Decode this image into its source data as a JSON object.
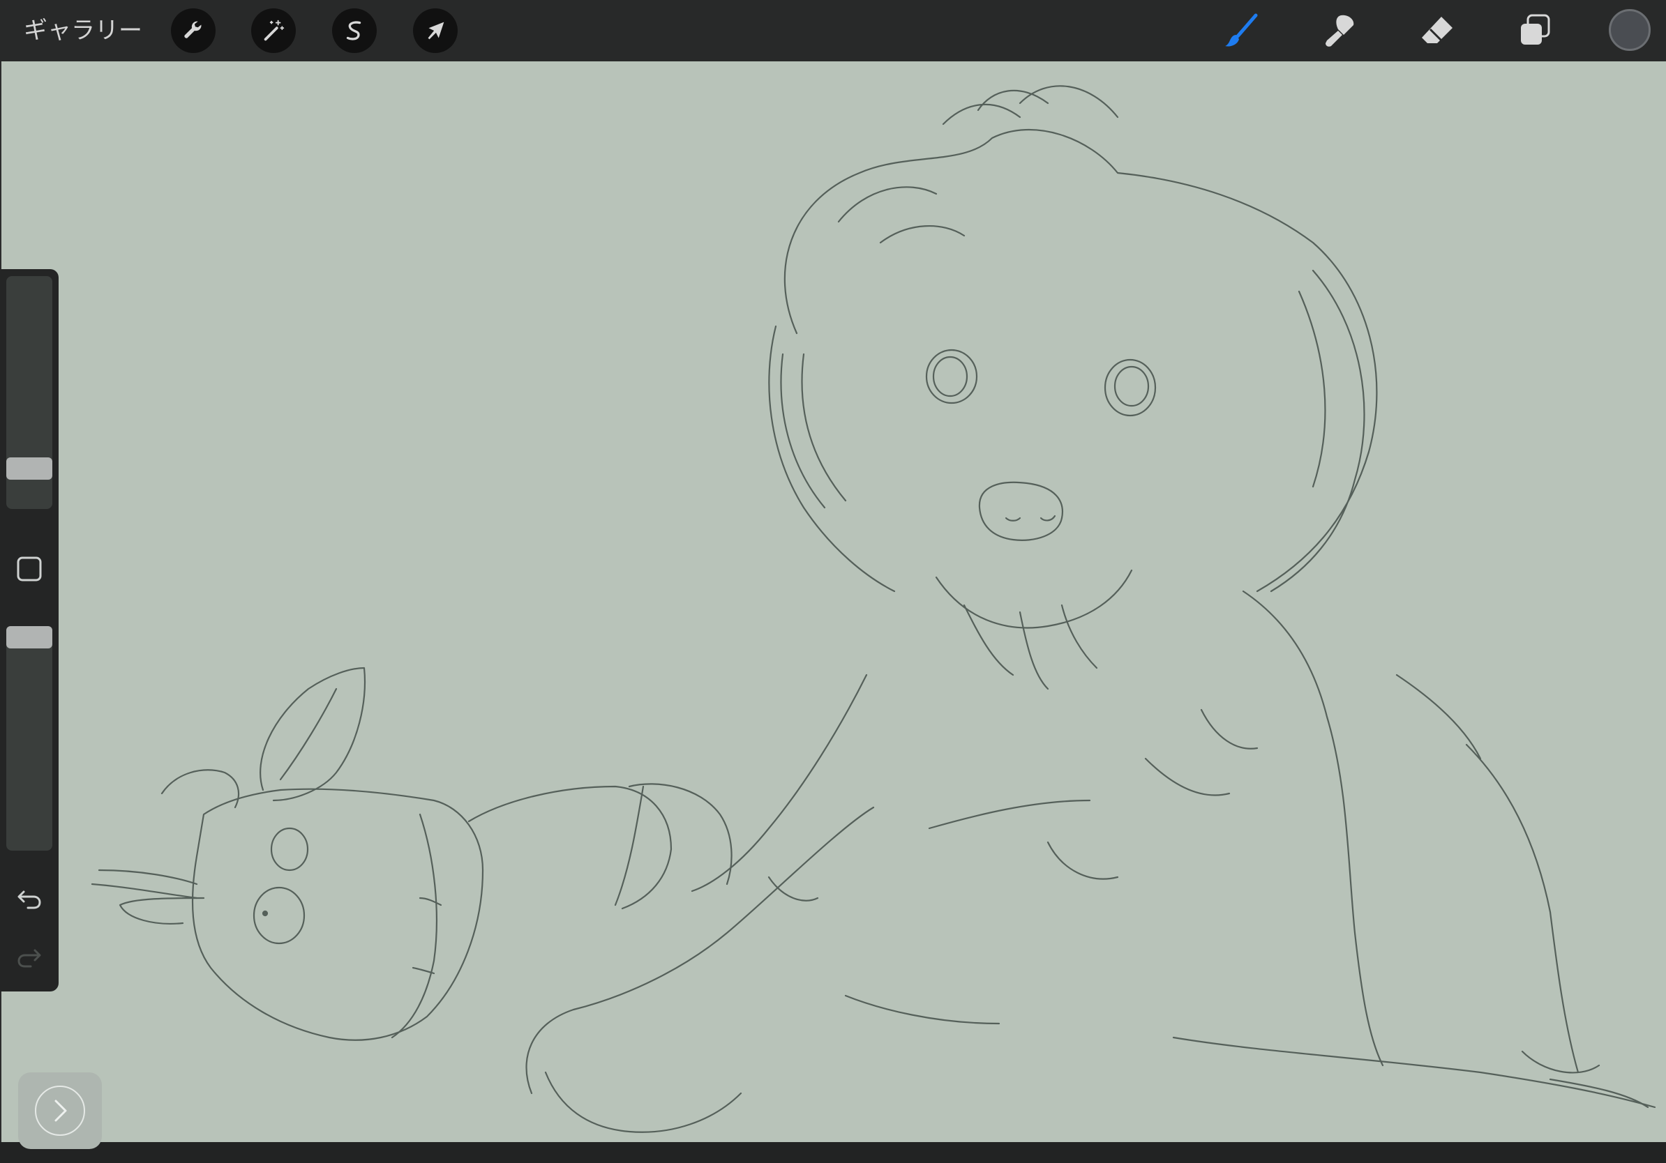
{
  "toolbar": {
    "gallery_label": "ギャラリー",
    "left_tools": [
      {
        "name": "actions",
        "icon": "wrench-icon"
      },
      {
        "name": "adjustments",
        "icon": "magic-wand-icon"
      },
      {
        "name": "selection",
        "icon": "selection-s-icon"
      },
      {
        "name": "transform",
        "icon": "arrow-cursor-icon"
      }
    ],
    "right_tools": [
      {
        "name": "brush",
        "icon": "brush-icon",
        "active": true
      },
      {
        "name": "smudge",
        "icon": "smudge-icon",
        "active": false
      },
      {
        "name": "eraser",
        "icon": "eraser-icon",
        "active": false
      },
      {
        "name": "layers",
        "icon": "layers-icon",
        "active": false
      }
    ],
    "color": "#4a4d52",
    "active_color": "#1e7cf0"
  },
  "sidebar": {
    "brush_size": 0.14,
    "brush_opacity": 1.0,
    "modify_icon": "square-icon",
    "undo_icon": "undo-icon",
    "redo_icon": "redo-icon",
    "redo_enabled": false
  },
  "canvas": {
    "background": "#b8c3b9",
    "stroke_color": "#55605a"
  },
  "quick_button": {
    "icon": "chevron-right-icon"
  }
}
